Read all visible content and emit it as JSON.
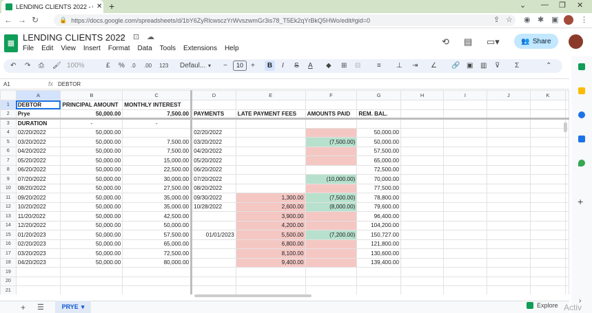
{
  "browser": {
    "tab_title": "LENDING CLIENTS 2022 - Googl",
    "tab_close": "✕",
    "new_tab": "+",
    "url": "https://docs.google.com/spreadsheets/d/1bY6ZyRlcwsczYrWvszwmGr3is78_T5Ek2qYrBkQ5HWo/edit#gid=0",
    "window_controls": [
      "⌄",
      "—",
      "❐",
      "✕"
    ]
  },
  "document": {
    "title": "LENDING CLIENTS 2022",
    "menu": [
      "File",
      "Edit",
      "View",
      "Insert",
      "Format",
      "Data",
      "Tools",
      "Extensions",
      "Help"
    ],
    "share_label": "Share"
  },
  "toolbar": {
    "zoom": "100%",
    "currency": "£",
    "percent": "%",
    "dec_decrease": ".0",
    "dec_increase": ".00",
    "number_format": "123",
    "font": "Defaul...",
    "font_size": "10",
    "bold": "B",
    "italic": "I",
    "text_color": "A"
  },
  "formula_bar": {
    "cell_ref": "A1",
    "fx": "fx",
    "value": "DEBTOR"
  },
  "columns": [
    "A",
    "B",
    "C",
    "D",
    "E",
    "F",
    "G",
    "H",
    "I",
    "J",
    "K"
  ],
  "rows": [
    {
      "n": "1",
      "cells": [
        "DEBTOR",
        "PRINCIPAL AMOUNT",
        "MONTHLY INTEREST",
        "",
        "",
        "",
        "",
        "",
        "",
        "",
        ""
      ]
    },
    {
      "n": "2",
      "cells": [
        "Prye",
        "50,000.00",
        "7,500.00",
        "PAYMENTS",
        "LATE PAYMENT FEES",
        "AMOUNTS PAID",
        "REM. BAL.",
        "",
        "",
        "",
        ""
      ]
    },
    {
      "n": "3",
      "cells": [
        "DURATION",
        "-",
        "-",
        "",
        "",
        "",
        "",
        "",
        "",
        "",
        ""
      ]
    },
    {
      "n": "4",
      "cells": [
        "02/20/2022",
        "50,000.00",
        "",
        "02/20/2022",
        "",
        "",
        "50,000.00",
        "",
        "",
        "",
        ""
      ]
    },
    {
      "n": "5",
      "cells": [
        "03/20/2022",
        "50,000.00",
        "7,500.00",
        "03/20/2022",
        "",
        "(7,500.00)",
        "50,000.00",
        "",
        "",
        "",
        ""
      ]
    },
    {
      "n": "6",
      "cells": [
        "04/20/2022",
        "50,000.00",
        "7,500.00",
        "04/20/2022",
        "",
        "",
        "57,500.00",
        "",
        "",
        "",
        ""
      ]
    },
    {
      "n": "7",
      "cells": [
        "05/20/2022",
        "50,000.00",
        "15,000.00",
        "05/20/2022",
        "",
        "",
        "65,000.00",
        "",
        "",
        "",
        ""
      ]
    },
    {
      "n": "8",
      "cells": [
        "06/20/2022",
        "50,000.00",
        "22,500.00",
        "06/20/2022",
        "",
        "",
        "72,500.00",
        "",
        "",
        "",
        ""
      ]
    },
    {
      "n": "9",
      "cells": [
        "07/20/2022",
        "50,000.00",
        "30,000.00",
        "07/20/2022",
        "",
        "(10,000.00)",
        "70,000.00",
        "",
        "",
        "",
        ""
      ]
    },
    {
      "n": "10",
      "cells": [
        "08/20/2022",
        "50,000.00",
        "27,500.00",
        "08/20/2022",
        "",
        "",
        "77,500.00",
        "",
        "",
        "",
        ""
      ]
    },
    {
      "n": "11",
      "cells": [
        "09/20/2022",
        "50,000.00",
        "35,000.00",
        "09/30/2022",
        "1,300.00",
        "(7,500.00)",
        "78,800.00",
        "",
        "",
        "",
        ""
      ]
    },
    {
      "n": "12",
      "cells": [
        "10/20/2022",
        "50,000.00",
        "35,000.00",
        "10/28/2022",
        "2,600.00",
        "(8,000.00)",
        "79,600.00",
        "",
        "",
        "",
        ""
      ]
    },
    {
      "n": "13",
      "cells": [
        "11/20/2022",
        "50,000.00",
        "42,500.00",
        "",
        "3,900.00",
        "",
        "96,400.00",
        "",
        "",
        "",
        ""
      ]
    },
    {
      "n": "14",
      "cells": [
        "12/20/2022",
        "50,000.00",
        "50,000.00",
        "",
        "4,200.00",
        "",
        "104,200.00",
        "",
        "",
        "",
        ""
      ]
    },
    {
      "n": "15",
      "cells": [
        "01/20/2023",
        "50,000.00",
        "57,500.00",
        "01/01/2023",
        "5,500.00",
        "(7,200.00)",
        "150,727.00",
        "",
        "",
        "",
        ""
      ]
    },
    {
      "n": "16",
      "cells": [
        "02/20/2023",
        "50,000.00",
        "65,000.00",
        "",
        "6,800.00",
        "",
        "121,800.00",
        "",
        "",
        "",
        ""
      ]
    },
    {
      "n": "17",
      "cells": [
        "03/20/2023",
        "50,000.00",
        "72,500.00",
        "",
        "8,100.00",
        "",
        "130,600.00",
        "",
        "",
        "",
        ""
      ]
    },
    {
      "n": "18",
      "cells": [
        "04/20/2023",
        "50,000.00",
        "80,000.00",
        "",
        "9,400.00",
        "",
        "139,400.00",
        "",
        "",
        "",
        ""
      ]
    },
    {
      "n": "19",
      "cells": [
        "",
        "",
        "",
        "",
        "",
        "",
        "",
        "",
        "",
        "",
        ""
      ]
    },
    {
      "n": "20",
      "cells": [
        "",
        "",
        "",
        "",
        "",
        "",
        "",
        "",
        "",
        "",
        ""
      ]
    },
    {
      "n": "21",
      "cells": [
        "",
        "",
        "",
        "",
        "",
        "",
        "",
        "",
        "",
        "",
        ""
      ]
    }
  ],
  "cell_colors": {
    "pink": "#f4c7c3",
    "green": "#b7e1cd",
    "selection": "#1a73e8",
    "share_bg": "#c2e7ff",
    "logo": "#0f9d58"
  },
  "sheet_tabs": [
    {
      "label": "PRYE",
      "active": true
    }
  ],
  "bottom": {
    "add_sheet": "+",
    "all_sheets": "☰",
    "explore": "Explore",
    "watermark": "Activ"
  }
}
